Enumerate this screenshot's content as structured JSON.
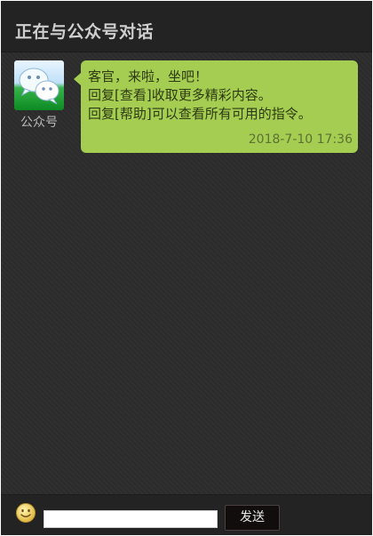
{
  "header": {
    "title": "正在与公众号对话"
  },
  "messages": [
    {
      "sender": "公众号",
      "avatar_icon": "wechat-logo-icon",
      "lines": [
        "客官，来啦，坐吧！",
        "回复[查看]收取更多精彩内容。",
        "回复[帮助]可以查看所有可用的指令。"
      ],
      "time": "2018-7-10 17:36"
    }
  ],
  "composer": {
    "emoji_icon": "smiley-face-icon",
    "input_value": "",
    "send_label": "发送"
  },
  "colors": {
    "background": "#2a2a2a",
    "header": "#232323",
    "bubble": "#a4cd52",
    "send_button": "#110d0d"
  }
}
